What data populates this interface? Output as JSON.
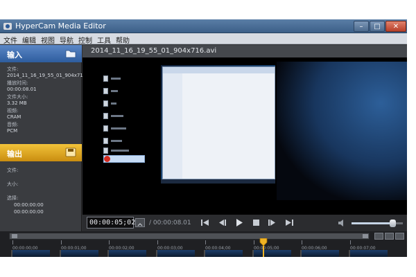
{
  "window": {
    "title": "HyperCam Media Editor",
    "min_symbol": "–",
    "max_symbol": "□",
    "close_symbol": "✕"
  },
  "menu": [
    "文件",
    "编辑",
    "视图",
    "导航",
    "控制",
    "工具",
    "帮助"
  ],
  "input_panel": {
    "header": "输入",
    "icon": "folder-icon",
    "file_label": "文件:",
    "file_value": "2014_11_16_19_55_01_904x71",
    "duration_label": "播放时间:",
    "duration_value": "00:00:08.01",
    "size_label": "文件大小:",
    "size_value": "3.32 MB",
    "video_label": "视频:",
    "video_value": "CRAM",
    "audio_label": "音频:",
    "audio_value": "PCM"
  },
  "output_panel": {
    "header": "输出",
    "icon": "save-icon",
    "file_label": "文件:",
    "size_label": "大小:",
    "range_label": "选择:",
    "start_value": "00:00:00:00",
    "end_value": "00:00:00:00"
  },
  "preview": {
    "filename": "2014_11_16_19_55_01_904x716.avi"
  },
  "transport": {
    "current_time": "00:00:05;02",
    "total_time": "/ 00:00:08.01",
    "buttons": [
      "skip-start-icon",
      "step-back-icon",
      "play-icon",
      "stop-icon",
      "step-forward-icon",
      "skip-end-icon"
    ],
    "volume_level": 0.8
  },
  "timeline": {
    "ticks": [
      "00:00:00;00",
      "00:00:01;00",
      "00:00:02;00",
      "00:00:03;00",
      "00:00:04;00",
      "00:00:05;00",
      "00:00:06;00",
      "00:00:07;00"
    ],
    "playhead_time": "00:00:05;02"
  },
  "colors": {
    "input_accent": "#3f6fb3",
    "output_accent": "#e3a823",
    "titlebar": "#4a6d96"
  }
}
